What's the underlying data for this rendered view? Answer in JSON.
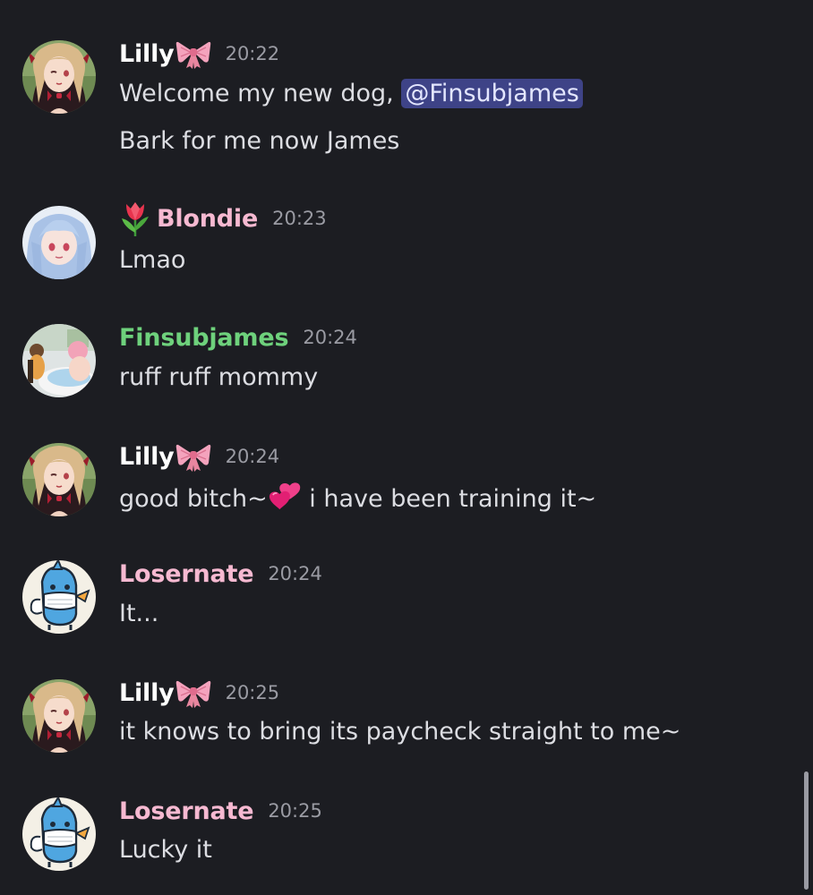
{
  "colors": {
    "background": "#1c1d22",
    "lilly": "#ffffff",
    "blondie": "#f6b9d1",
    "finsubjames": "#6ed17c",
    "losernate": "#f6b9d1",
    "mention_bg": "#3e4387"
  },
  "messages": [
    {
      "author": "Lilly",
      "author_emoji": "ribbon-emoji",
      "time": "20:22",
      "lines": [
        "Welcome my new dog, ",
        "Bark for me now James"
      ],
      "mention": "@Finsubjames"
    },
    {
      "author": "Blondie",
      "author_prefix_emoji": "tulip-emoji",
      "time": "20:23",
      "lines": [
        "Lmao"
      ]
    },
    {
      "author": "Finsubjames",
      "time": "20:24",
      "lines": [
        "ruff ruff mommy"
      ]
    },
    {
      "author": "Lilly",
      "author_emoji": "ribbon-emoji",
      "time": "20:24",
      "line_parts": [
        "good bitch~",
        " i have been training it~"
      ],
      "inline_emoji": "two-hearts-emoji"
    },
    {
      "author": "Losernate",
      "time": "20:24",
      "lines": [
        "It..."
      ]
    },
    {
      "author": "Lilly",
      "author_emoji": "ribbon-emoji",
      "time": "20:25",
      "lines": [
        "it knows to bring its paycheck straight to me~"
      ]
    },
    {
      "author": "Losernate",
      "time": "20:25",
      "lines": [
        "Lucky it"
      ]
    }
  ]
}
